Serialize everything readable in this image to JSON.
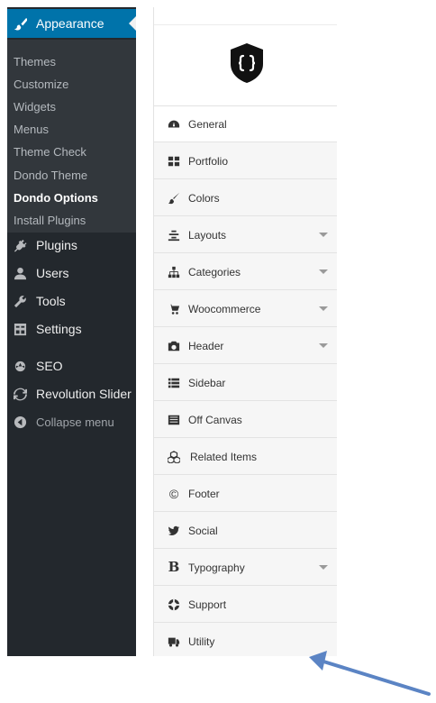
{
  "sidebar": {
    "appearance": "Appearance",
    "submenu": [
      "Themes",
      "Customize",
      "Widgets",
      "Menus",
      "Theme Check",
      "Dondo Theme",
      "Dondo Options",
      "Install Plugins"
    ],
    "current_submenu": "Dondo Options",
    "menu": [
      "Plugins",
      "Users",
      "Tools",
      "Settings",
      "SEO",
      "Revolution Slider"
    ],
    "collapse": "Collapse menu"
  },
  "options": {
    "active": "General",
    "items": [
      "General",
      "Portfolio",
      "Colors",
      "Layouts",
      "Categories",
      "Woocommerce",
      "Header",
      "Sidebar",
      "Off Canvas",
      "Related Items",
      "Footer",
      "Social",
      "Typography",
      "Support",
      "Utility"
    ],
    "expandable": [
      "Layouts",
      "Categories",
      "Woocommerce",
      "Header",
      "Typography"
    ]
  },
  "icons": {
    "appearance": "paintbrush-icon",
    "plugins": "plug-icon",
    "users": "user-icon",
    "tools": "wrench-icon",
    "settings": "settings-icon",
    "seo": "seo-icon",
    "revolution_slider": "refresh-icon",
    "collapse": "collapse-icon",
    "logo": "shield-braces-logo"
  },
  "colors": {
    "sidebar_bg": "#23282d",
    "submenu_bg": "#32373c",
    "accent": "#0073aa",
    "panel_bg": "#f6f6f6",
    "arrow": "#5b84c4"
  }
}
